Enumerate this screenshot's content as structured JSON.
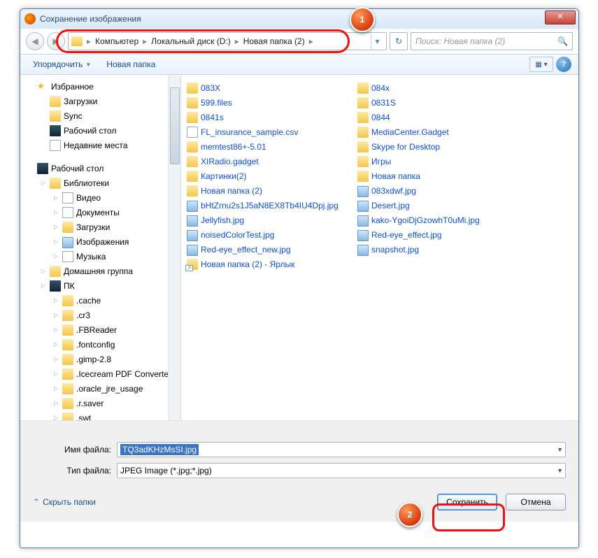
{
  "window": {
    "title": "Сохранение изображения"
  },
  "nav": {
    "breadcrumb": [
      "Компьютер",
      "Локальный диск (D:)",
      "Новая папка (2)"
    ],
    "search_placeholder": "Поиск: Новая папка (2)"
  },
  "toolbar": {
    "organize": "Упорядочить",
    "newfolder": "Новая папка"
  },
  "tree": {
    "favorites": {
      "label": "Избранное",
      "items": [
        "Загрузки",
        "Sync",
        "Рабочий стол",
        "Недавние места"
      ]
    },
    "desktop": {
      "label": "Рабочий стол"
    },
    "libraries": {
      "label": "Библиотеки",
      "items": [
        "Видео",
        "Документы",
        "Загрузки",
        "Изображения",
        "Музыка"
      ]
    },
    "homegroup": {
      "label": "Домашняя группа"
    },
    "pc": {
      "label": "ПК",
      "items": [
        ".cache",
        ".cr3",
        ".FBReader",
        ".fontconfig",
        ".gimp-2.8",
        ".Icecream PDF Converter",
        ".oracle_jre_usage",
        ".r.saver",
        ".swt"
      ]
    }
  },
  "files": {
    "col1": [
      {
        "t": "folder",
        "n": "083X"
      },
      {
        "t": "folder",
        "n": "599.files"
      },
      {
        "t": "folder",
        "n": "0841s"
      },
      {
        "t": "file",
        "n": "FL_insurance_sample.csv"
      },
      {
        "t": "folder",
        "n": "memtest86+-5.01"
      },
      {
        "t": "folder",
        "n": "XIRadio.gadget"
      },
      {
        "t": "folder",
        "n": "Картинки(2)"
      },
      {
        "t": "folder",
        "n": "Новая папка (2)"
      },
      {
        "t": "img",
        "n": "bHtZrnu2s1J5aN8EX8Tb4IU4Dpj.jpg"
      },
      {
        "t": "img",
        "n": "Jellyfish.jpg"
      },
      {
        "t": "img",
        "n": "noisedColorTest.jpg"
      },
      {
        "t": "img",
        "n": "Red-eye_effect_new.jpg"
      },
      {
        "t": "lnk",
        "n": "Новая папка (2) - Ярлык"
      }
    ],
    "col2": [
      {
        "t": "folder",
        "n": "084x"
      },
      {
        "t": "folder",
        "n": "0831S"
      },
      {
        "t": "folder",
        "n": "0844"
      },
      {
        "t": "folder",
        "n": "MediaCenter.Gadget"
      },
      {
        "t": "folder",
        "n": "Skype for Desktop"
      },
      {
        "t": "folder",
        "n": "Игры"
      },
      {
        "t": "folder",
        "n": "Новая папка"
      },
      {
        "t": "img",
        "n": "083xdwf.jpg"
      },
      {
        "t": "img",
        "n": "Desert.jpg"
      },
      {
        "t": "img",
        "n": "kako-YgoiDjGzowhT0uMi.jpg"
      },
      {
        "t": "img",
        "n": "Red-eye_effect.jpg"
      },
      {
        "t": "img",
        "n": "snapshot.jpg"
      }
    ]
  },
  "form": {
    "filename_label": "Имя файла:",
    "filename_value": "TQ3adKHzMsSI.jpg",
    "filetype_label": "Тип файла:",
    "filetype_value": "JPEG Image (*.jpg;*.jpg)"
  },
  "footer": {
    "hide_folders": "Скрыть папки",
    "save": "Сохранить",
    "cancel": "Отмена"
  },
  "callouts": {
    "c1": "1",
    "c2": "2"
  }
}
